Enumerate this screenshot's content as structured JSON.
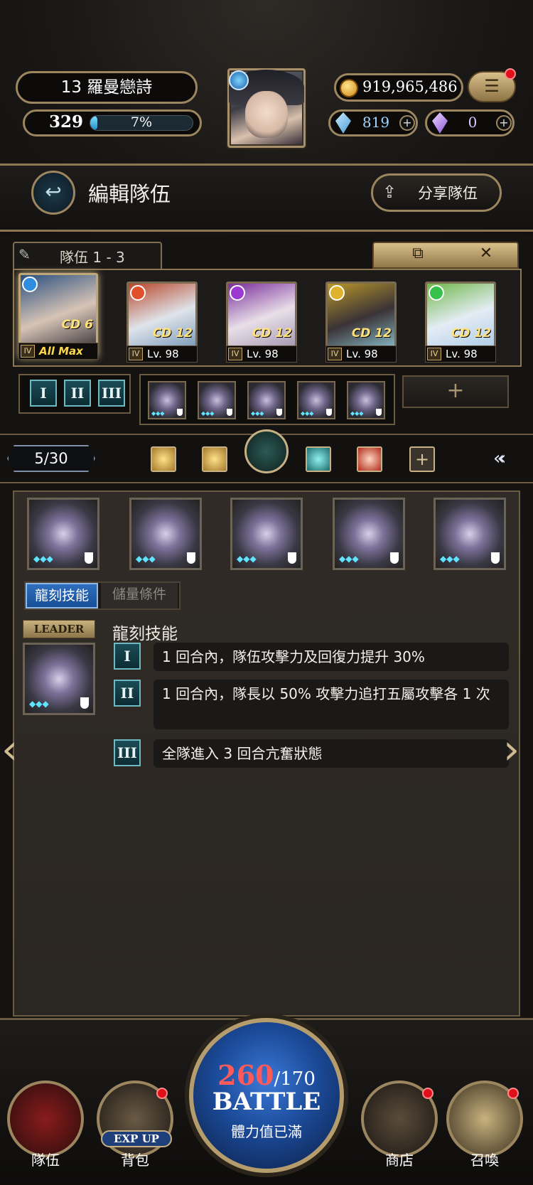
{
  "player": {
    "name": "13 羅曼戀詩",
    "level": "329",
    "exp_text": "7%",
    "exp_fraction": 0.07
  },
  "currency": {
    "coins": "919,965,486",
    "gems_blue": "819",
    "gems_purple": "0"
  },
  "header": {
    "title": "編輯隊伍",
    "share_label": "分享隊伍",
    "menu_glyph": "☰",
    "back_glyph": "↩",
    "share_glyph": "⇪"
  },
  "team": {
    "tab_label": "隊伍 1 - 3",
    "copy_glyph": "⧉",
    "close_glyph": "✕",
    "members": [
      {
        "cd": "CD 6",
        "rank": "IV",
        "level": "All Max",
        "attr_color": "#2f8de0",
        "art": [
          "#2a4f7e",
          "#d7c4b6",
          "#1e1d25"
        ]
      },
      {
        "cd": "CD 12",
        "rank": "IV",
        "level": "Lv. 98",
        "attr_color": "#e0502a",
        "art": [
          "#b8462a",
          "#dfe4ea",
          "#6d8fb2"
        ]
      },
      {
        "cd": "CD 12",
        "rank": "IV",
        "level": "Lv. 98",
        "attr_color": "#9a3ad0",
        "art": [
          "#7a2d9a",
          "#e8dfe8",
          "#9a8ea8"
        ]
      },
      {
        "cd": "CD 12",
        "rank": "IV",
        "level": "Lv. 98",
        "attr_color": "#e0b12a",
        "art": [
          "#b8962a",
          "#3a3336",
          "#8fc9d8"
        ]
      },
      {
        "cd": "CD 12",
        "rank": "IV",
        "level": "Lv. 98",
        "attr_color": "#36c24a",
        "art": [
          "#6fb84a",
          "#e4ecf4",
          "#a6c8e6"
        ]
      }
    ],
    "roman_buttons": [
      "I",
      "II",
      "III"
    ],
    "add_glyph": "+"
  },
  "filter": {
    "count": "5/30",
    "icons": [
      "head-gold-icon",
      "head-gold-icon",
      "butterfly-icon",
      "butterfly-icon",
      "rose-icon",
      "plus-icon"
    ],
    "chevrons": "«‹"
  },
  "panel": {
    "tabs": [
      "龍刻技能",
      "儲量條件"
    ],
    "leader_tag": "LEADER",
    "skill_title": "龍刻技能",
    "skills": [
      {
        "num": "I",
        "text": "1 回合內，隊伍攻擊力及回復力提升 30%"
      },
      {
        "num": "II",
        "text": "1 回合內，隊長以 50% 攻擊力追打五屬攻擊各 1 次"
      },
      {
        "num": "III",
        "text": "全隊進入 3 回合亢奮狀態"
      }
    ],
    "diamond_glyph": "◆◆◆"
  },
  "nav": {
    "items": [
      {
        "label": "隊伍",
        "badge": false
      },
      {
        "label": "背包",
        "badge": true,
        "extra": "EXP UP"
      },
      {
        "label": "商店",
        "badge": true
      },
      {
        "label": "召喚",
        "badge": true
      }
    ],
    "stamina_current": "260",
    "stamina_max": "/170",
    "battle_label": "BATTLE",
    "battle_sub": "體力值已滿"
  }
}
